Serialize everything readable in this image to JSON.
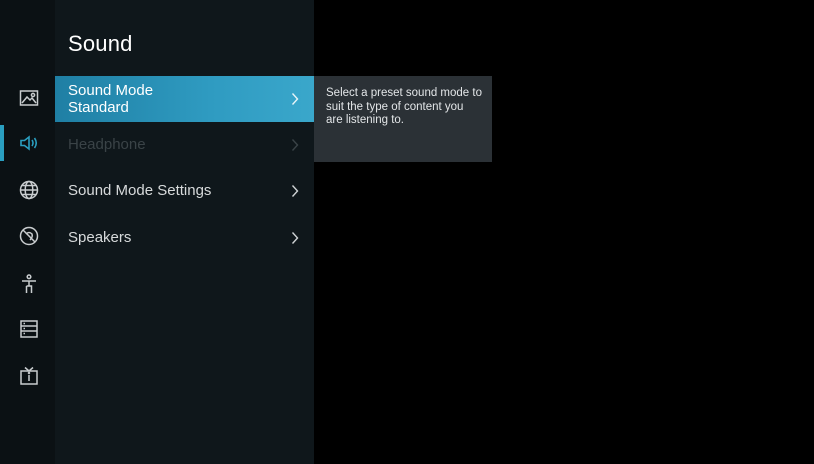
{
  "panel": {
    "title": "Sound",
    "items": [
      {
        "label_line1": "Sound Mode",
        "label_line2": "Standard",
        "state": "selected"
      },
      {
        "label": "Headphone",
        "state": "disabled"
      },
      {
        "label": "Sound Mode Settings",
        "state": "normal"
      },
      {
        "label": "Speakers",
        "state": "normal"
      }
    ]
  },
  "description": {
    "text": "Select a preset sound mode to suit the type of content you are listening to."
  },
  "rail": {
    "icons": [
      "picture-icon",
      "sound-icon",
      "network-globe-icon",
      "privacy-icon",
      "accessibility-icon",
      "system-list-icon",
      "tv-info-icon"
    ],
    "active": "sound-icon",
    "accent_color": "#2a9fc0"
  },
  "colors": {
    "background": "#000000",
    "panel": "#0f171b",
    "rail": "#0b1114",
    "selected": "#2f9bc1",
    "description_box": "#2b3136"
  }
}
